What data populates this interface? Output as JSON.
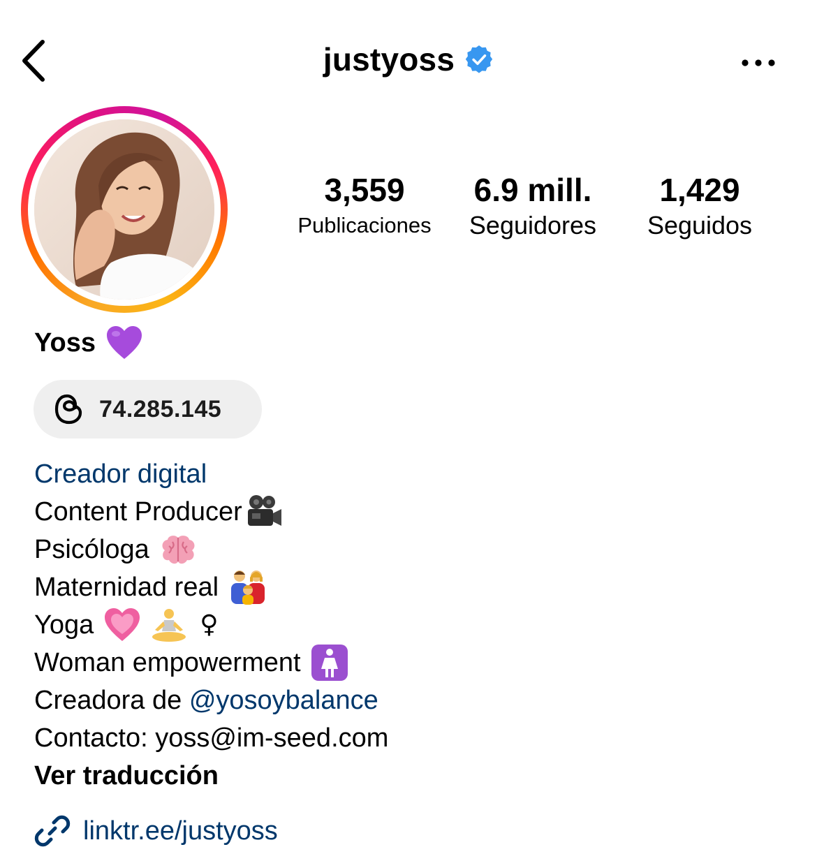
{
  "header": {
    "username": "justyoss",
    "back_icon": "chevron-left-icon",
    "verified_icon": "verified-badge-icon",
    "more_icon": "more-horizontal-icon"
  },
  "stats": {
    "posts": {
      "value": "3,559",
      "label": "Publicaciones"
    },
    "followers": {
      "value": "6.9 mill.",
      "label": "Seguidores"
    },
    "following": {
      "value": "1,429",
      "label": "Seguidos"
    }
  },
  "profile": {
    "display_name": "Yoss",
    "name_emoji": "💜",
    "threads_count": "74.285.145",
    "threads_icon": "threads-icon"
  },
  "bio": {
    "category": "Creador digital",
    "lines": [
      {
        "text": "Content Producer",
        "emoji": "🎥"
      },
      {
        "text": "Psicóloga",
        "emoji": "🧠"
      },
      {
        "text": "Maternidad real",
        "emoji": "👨‍👩‍👧"
      },
      {
        "text": "Yoga",
        "emoji": "💗 🧘 ♀"
      },
      {
        "text": "Woman empowerment",
        "emoji": "🚺"
      }
    ],
    "creator_prefix": "Creadora de ",
    "creator_mention": "@yosoybalance",
    "contact": "Contacto: yoss@im-seed.com",
    "see_translation": "Ver traducción"
  },
  "link": {
    "url_text": "linktr.ee/justyoss",
    "icon": "link-icon"
  },
  "colors": {
    "link_blue": "#00376b",
    "verified_blue": "#3897f0",
    "pill_bg": "#efefef"
  }
}
